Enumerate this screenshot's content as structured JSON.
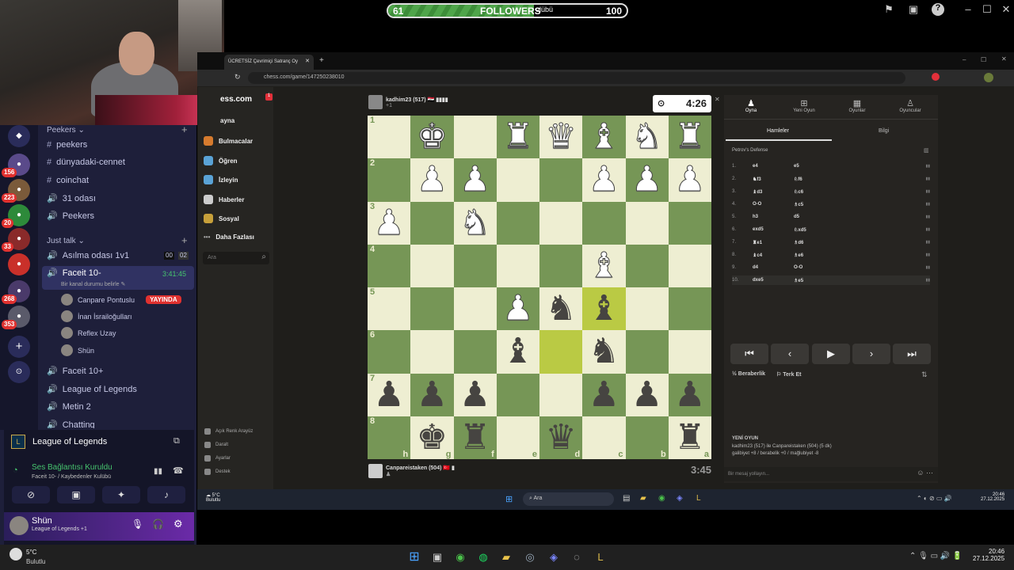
{
  "followers_bar": {
    "current": "61",
    "label": "FOLLOWERS",
    "overlay": "ulübü",
    "goal": "100",
    "progress": 0.61
  },
  "discord": {
    "guild_badges": [
      "156",
      "223",
      "20",
      "33",
      "268",
      "353"
    ],
    "category1": "Peekers",
    "channels1": [
      "peekers",
      "dünyadaki-cennet",
      "coinchat",
      "31 odası",
      "Peekers"
    ],
    "category2": "Just talk",
    "voice1": {
      "name": "Asılma odası 1v1",
      "count1": "00",
      "count2": "02"
    },
    "active_voice": {
      "name": "Faceit 10-",
      "timer": "3:41:45",
      "status": "Bir kanal durumu belirle"
    },
    "voice_users": [
      {
        "name": "Canpare Pontuslu",
        "live": "YAYINDA"
      },
      {
        "name": "İnan İsrailoğulları"
      },
      {
        "name": "Reflex Uzay"
      },
      {
        "name": "Shün"
      }
    ],
    "voice_channels": [
      "Faceit 10+",
      "League of Legends",
      "Metin 2",
      "Chatting"
    ],
    "activity": "League of Legends",
    "connection": {
      "title": "Ses Bağlantısı Kuruldu",
      "subtitle": "Faceit 10- / Kaybedenler Kulübü"
    },
    "user": {
      "name": "Shün",
      "status": "League of Legends +1"
    }
  },
  "browser": {
    "tab_title": "ÜCRETSİZ Çevrimiçi Satranç Oy",
    "url": "chess.com/game/147250238010"
  },
  "chess_sidebar": {
    "logo": "ess.com",
    "nav": [
      "ayna",
      "Bulmacalar",
      "Öğren",
      "İzleyin",
      "Haberler",
      "Sosyal",
      "Daha Fazlası"
    ],
    "search_placeholder": "Ara",
    "bottom": [
      "Açık Renk Arayüz",
      "Daralt",
      "Ayarlar",
      "Destek"
    ]
  },
  "game": {
    "top_player": "kadhim23 (517)",
    "top_player_sub": "+1",
    "top_clock": "4:26",
    "bottom_player": "Canpareistaken (504)",
    "bottom_clock": "3:45",
    "ranks": [
      "1",
      "2",
      "3",
      "4",
      "5",
      "6",
      "7",
      "8"
    ],
    "files": [
      "h",
      "g",
      "f",
      "e",
      "d",
      "c",
      "b",
      "a"
    ],
    "board": [
      [
        "",
        "wK",
        "",
        "wR",
        "wQ",
        "wB",
        "wN",
        "wR"
      ],
      [
        "",
        "wP",
        "wP",
        "",
        "",
        "wP",
        "wP",
        "wP"
      ],
      [
        "wP",
        "",
        "wN",
        "",
        "",
        "",
        "",
        ""
      ],
      [
        "",
        "",
        "",
        "",
        "",
        "wB",
        "",
        ""
      ],
      [
        "",
        "",
        "",
        "wP",
        "bN",
        "bB",
        "",
        ""
      ],
      [
        "",
        "",
        "",
        "bB",
        "",
        "bN",
        "",
        ""
      ],
      [
        "bP",
        "bP",
        "bP",
        "",
        "",
        "bP",
        "bP",
        "bP"
      ],
      [
        "",
        "bK",
        "bR",
        "",
        "bQ",
        "",
        "",
        "bR"
      ]
    ]
  },
  "panel": {
    "tabs": [
      "Oyna",
      "Yeni Oyun",
      "Oyunlar",
      "Oyuncular"
    ],
    "subtabs": [
      "Hamleler",
      "Bilgi"
    ],
    "opening": "Petrov's Defense",
    "moves": [
      {
        "n": "1.",
        "w": "e4",
        "b": "e5"
      },
      {
        "n": "2.",
        "w": "♞f3",
        "b": "♘f6"
      },
      {
        "n": "3.",
        "w": "♝d3",
        "b": "♘c6"
      },
      {
        "n": "4.",
        "w": "O-O",
        "b": "♗c5"
      },
      {
        "n": "5.",
        "w": "h3",
        "b": "d5"
      },
      {
        "n": "6.",
        "w": "exd5",
        "b": "♘xd5"
      },
      {
        "n": "7.",
        "w": "♜e1",
        "b": "♗d6"
      },
      {
        "n": "8.",
        "w": "♝c4",
        "b": "♗e6"
      },
      {
        "n": "9.",
        "w": "d4",
        "b": "O-O"
      },
      {
        "n": "10.",
        "w": "dxe5",
        "b": "♗e5"
      }
    ],
    "actions": [
      "Beraberlik",
      "Terk Et"
    ],
    "new_game": "YENİ OYUN",
    "result_line1": "kadhim23 (517) ile Canpareistaken (504) (5 dk)",
    "result_line2": "galibiyet +8 / berabelik +0 / mağlubiyet -8",
    "message_placeholder": "Bir mesaj yollayın..."
  },
  "inner_taskbar": {
    "weather": "5°C",
    "weather_sub": "Bulutlu",
    "search": "Ara",
    "time": "20:46",
    "date": "27.12.2025"
  },
  "taskbar": {
    "weather": "5°C",
    "weather_sub": "Bulutlu",
    "time": "20:46",
    "date": "27.12.2025"
  }
}
